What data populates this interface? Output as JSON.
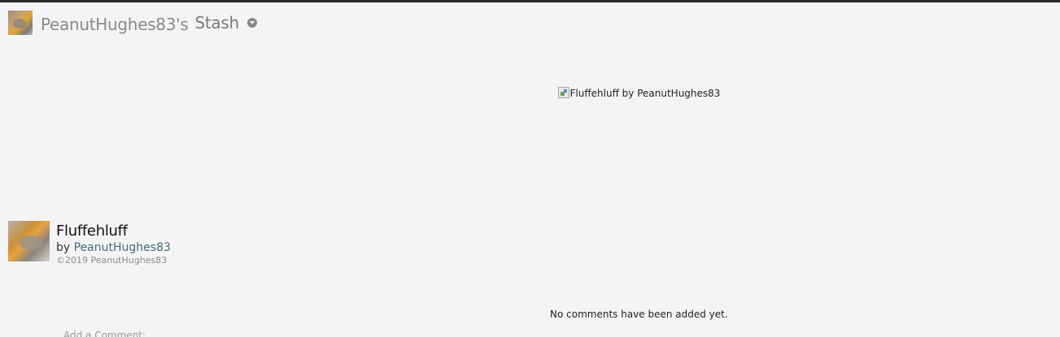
{
  "header": {
    "username": "PeanutHughes83's",
    "section": "Stash",
    "dropdown_icon": "chevron-down-circle-icon"
  },
  "image": {
    "alt_text": "Fluffehluff by PeanutHughes83",
    "broken_icon": "broken-image-icon"
  },
  "deviation": {
    "title": "Fluffehluff",
    "by_prefix": "by",
    "author": "PeanutHughes83",
    "copyright": "©2019 PeanutHughes83"
  },
  "comments": {
    "empty_message": "No comments have been added yet.",
    "add_label": "Add a Comment:"
  }
}
